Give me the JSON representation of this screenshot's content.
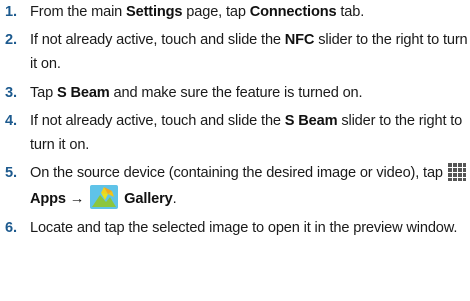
{
  "steps": [
    {
      "num": "1.",
      "p1": "From the main ",
      "b1": "Settings",
      "p2": " page, tap ",
      "b2": "Connections",
      "p3": " tab."
    },
    {
      "num": "2.",
      "p1": "If not already active, touch and slide the ",
      "b1": "NFC",
      "p2": " slider to the right to turn it on."
    },
    {
      "num": "3.",
      "p1": "Tap ",
      "b1": "S Beam",
      "p2": " and make sure the feature is turned on."
    },
    {
      "num": "4.",
      "p1": "If not already active, touch and slide the ",
      "b1": "S Beam",
      "p2": " slider to the right to turn it on."
    },
    {
      "num": "5.",
      "p1": "On the source device (containing the desired image or video), tap ",
      "b1": "Apps",
      "arrow": "→",
      "b2": "Gallery",
      "p2": "."
    },
    {
      "num": "6.",
      "p1": "Locate and tap the selected image to open it in the preview window."
    }
  ],
  "icons": {
    "apps": "apps-grid-icon",
    "gallery": "gallery-icon"
  },
  "colors": {
    "step_number": "#1d5a8e",
    "text": "#1a1a1a"
  }
}
